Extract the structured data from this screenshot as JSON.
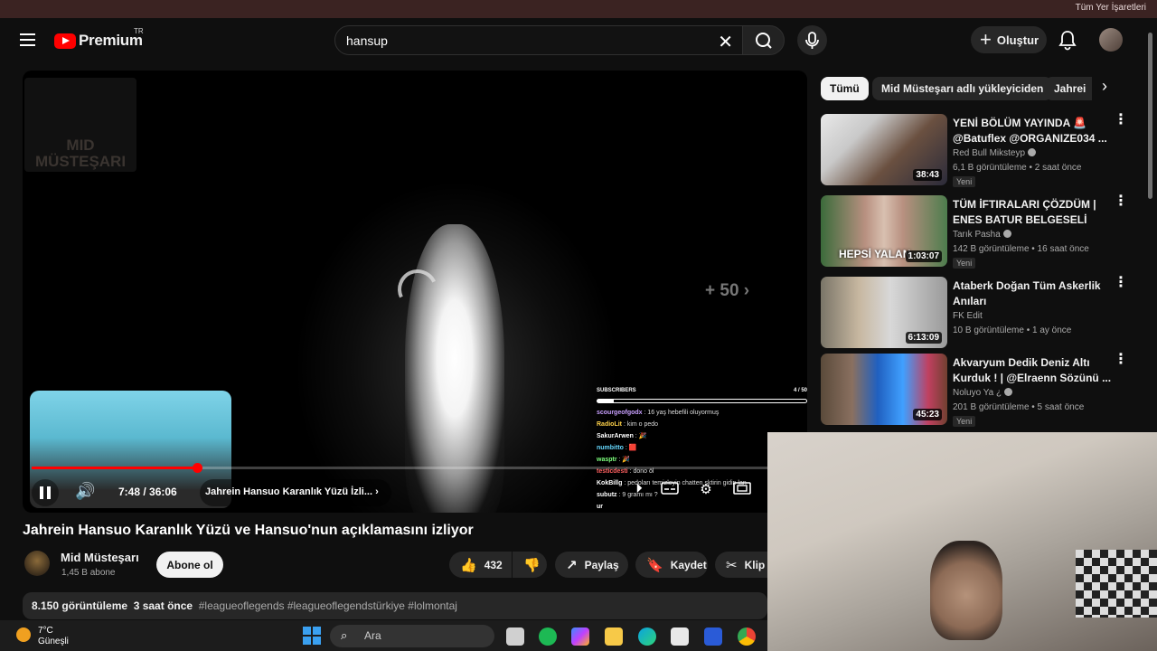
{
  "browser": {
    "bookmarks_label": "Tüm Yer İşaretleri"
  },
  "header": {
    "logo_text": "Premium",
    "logo_region": "TR",
    "search_value": "hansup",
    "create_label": "Oluştur"
  },
  "player": {
    "channel_watermark": "MID MÜSTEŞARI",
    "skip_label": "+ 50",
    "time": "7:48 / 36:06",
    "chapter": "Jahrein Hansuo Karanlık Yüzü İzli...",
    "progress": 0.216,
    "chat": {
      "header": "SUBSCRIBERS",
      "count": "4 / 50",
      "messages": [
        {
          "user": "scourgeofgodx",
          "text": ": 16 yaş hebefili oluyormuş",
          "color": "#c9a0ff"
        },
        {
          "user": "RadioLit",
          "text": ": kim o pedo",
          "color": "#ffd24a"
        },
        {
          "user": "SakurArwen",
          "text": ": 🎉",
          "color": "#ffffff"
        },
        {
          "user": "numbitto",
          "text": ": 🟥",
          "color": "#66d9ff"
        },
        {
          "user": "wasptr",
          "text": ": 🎉",
          "color": "#7dff7d"
        },
        {
          "user": "testicdesti",
          "text": ": dono öl",
          "color": "#ff6060"
        },
        {
          "user": "KokBillg",
          "text": ": pedoları temizleyin chatten sktirin gidin lan",
          "color": "#ffffff"
        },
        {
          "user": "subutz",
          "text": ": 9 gramı mı ?",
          "color": "#ffffff"
        },
        {
          "user": "ur",
          "text": "",
          "color": "#ffffff"
        }
      ]
    }
  },
  "video": {
    "title": "Jahrein Hansuo Karanlık Yüzü ve Hansuo'nun açıklamasını izliyor",
    "channel": "Mid Müsteşarı",
    "subscribers": "1,45 B abone",
    "subscribe_label": "Abone ol",
    "likes": "432",
    "share_label": "Paylaş",
    "save_label": "Kaydet",
    "clip_label": "Klip",
    "views": "8.150 görüntüleme",
    "posted": "3 saat önce",
    "tags": "#leagueoflegends #leagueoflegendstürkiye #lolmontaj"
  },
  "sidebar": {
    "chips": [
      "Tümü",
      "Mid Müsteşarı adlı yükleyiciden",
      "Jahrei"
    ],
    "recommendations": [
      {
        "title": "YENİ BÖLÜM YAYINDA 🚨 @Batuflex @ORGANIZE034 ...",
        "channel": "Red Bull Miksteyp",
        "meta": "6,1 B görüntüleme • 2 saat önce",
        "badge": "Yeni",
        "duration": "38:43",
        "verified": true
      },
      {
        "title": "TÜM İFTIRALARI ÇÖZDÜM | ENES BATUR BELGESELİ",
        "channel": "Tarık Pasha",
        "meta": "142 B görüntüleme • 16 saat önce",
        "badge": "Yeni",
        "duration": "1:03:07",
        "thumb_text": "HEPSİ YALAN",
        "verified": true
      },
      {
        "title": "Ataberk Doğan Tüm Askerlik Anıları",
        "channel": "FK Edit",
        "meta": "10 B görüntüleme • 1 ay önce",
        "badge": "",
        "duration": "6:13:09",
        "verified": false
      },
      {
        "title": "Akvaryum Dedik Deniz Altı Kurduk ! | @Elraenn Sözünü ...",
        "channel": "Noluyo Ya ¿",
        "meta": "201 B görüntüleme • 5 saat önce",
        "badge": "Yeni",
        "duration": "45:23",
        "verified": true
      }
    ]
  },
  "taskbar": {
    "temperature": "7°C",
    "weather": "Güneşli",
    "search_label": "Ara"
  }
}
